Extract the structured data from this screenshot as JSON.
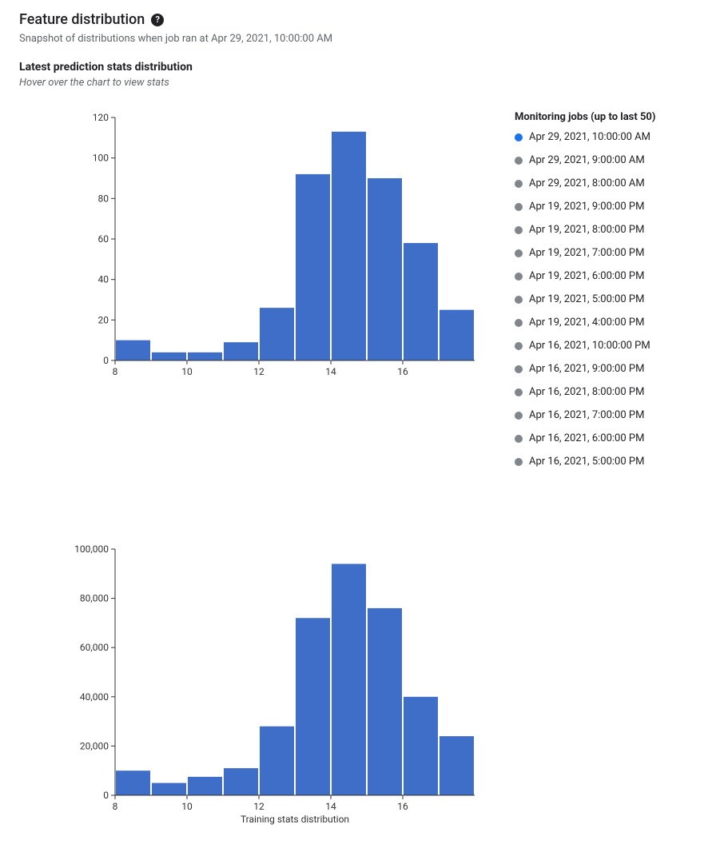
{
  "header": {
    "title": "Feature distribution",
    "help_tooltip": "?",
    "subtitle": "Snapshot of distributions when job ran at Apr 29, 2021, 10:00:00 AM"
  },
  "section": {
    "title": "Latest prediction stats distribution",
    "hint": "Hover over the chart to view stats"
  },
  "jobs": {
    "title": "Monitoring jobs (up to last 50)",
    "items": [
      {
        "label": "Apr 29, 2021, 10:00:00 AM",
        "selected": true
      },
      {
        "label": "Apr 29, 2021, 9:00:00 AM",
        "selected": false
      },
      {
        "label": "Apr 29, 2021, 8:00:00 AM",
        "selected": false
      },
      {
        "label": "Apr 19, 2021, 9:00:00 PM",
        "selected": false
      },
      {
        "label": "Apr 19, 2021, 8:00:00 PM",
        "selected": false
      },
      {
        "label": "Apr 19, 2021, 7:00:00 PM",
        "selected": false
      },
      {
        "label": "Apr 19, 2021, 6:00:00 PM",
        "selected": false
      },
      {
        "label": "Apr 19, 2021, 5:00:00 PM",
        "selected": false
      },
      {
        "label": "Apr 19, 2021, 4:00:00 PM",
        "selected": false
      },
      {
        "label": "Apr 16, 2021, 10:00:00 PM",
        "selected": false
      },
      {
        "label": "Apr 16, 2021, 9:00:00 PM",
        "selected": false
      },
      {
        "label": "Apr 16, 2021, 8:00:00 PM",
        "selected": false
      },
      {
        "label": "Apr 16, 2021, 7:00:00 PM",
        "selected": false
      },
      {
        "label": "Apr 16, 2021, 6:00:00 PM",
        "selected": false
      },
      {
        "label": "Apr 16, 2021, 5:00:00 PM",
        "selected": false
      }
    ]
  },
  "chart_data": [
    {
      "type": "bar",
      "title": "",
      "xlabel": "",
      "ylabel": "",
      "x_ticks": [
        8,
        10,
        12,
        14,
        16
      ],
      "y_ticks": [
        0,
        20,
        40,
        60,
        80,
        100,
        120
      ],
      "y_tick_labels": [
        "0",
        "20",
        "40",
        "60",
        "80",
        "100",
        "120"
      ],
      "ylim": [
        0,
        120
      ],
      "categories": [
        8,
        9,
        10,
        11,
        12,
        13,
        14,
        15,
        16,
        17
      ],
      "values": [
        10,
        4,
        4,
        9,
        26,
        92,
        113,
        90,
        58,
        25
      ]
    },
    {
      "type": "bar",
      "title": "",
      "xlabel": "Training stats distribution",
      "ylabel": "",
      "x_ticks": [
        8,
        10,
        12,
        14,
        16
      ],
      "y_ticks": [
        0,
        20000,
        40000,
        60000,
        80000,
        100000
      ],
      "y_tick_labels": [
        "0",
        "20,000",
        "40,000",
        "60,000",
        "80,000",
        "100,000"
      ],
      "ylim": [
        0,
        100000
      ],
      "categories": [
        8,
        9,
        10,
        11,
        12,
        13,
        14,
        15,
        16,
        17
      ],
      "values": [
        10000,
        5000,
        7500,
        11000,
        28000,
        72000,
        94000,
        76000,
        40000,
        24000
      ]
    }
  ]
}
